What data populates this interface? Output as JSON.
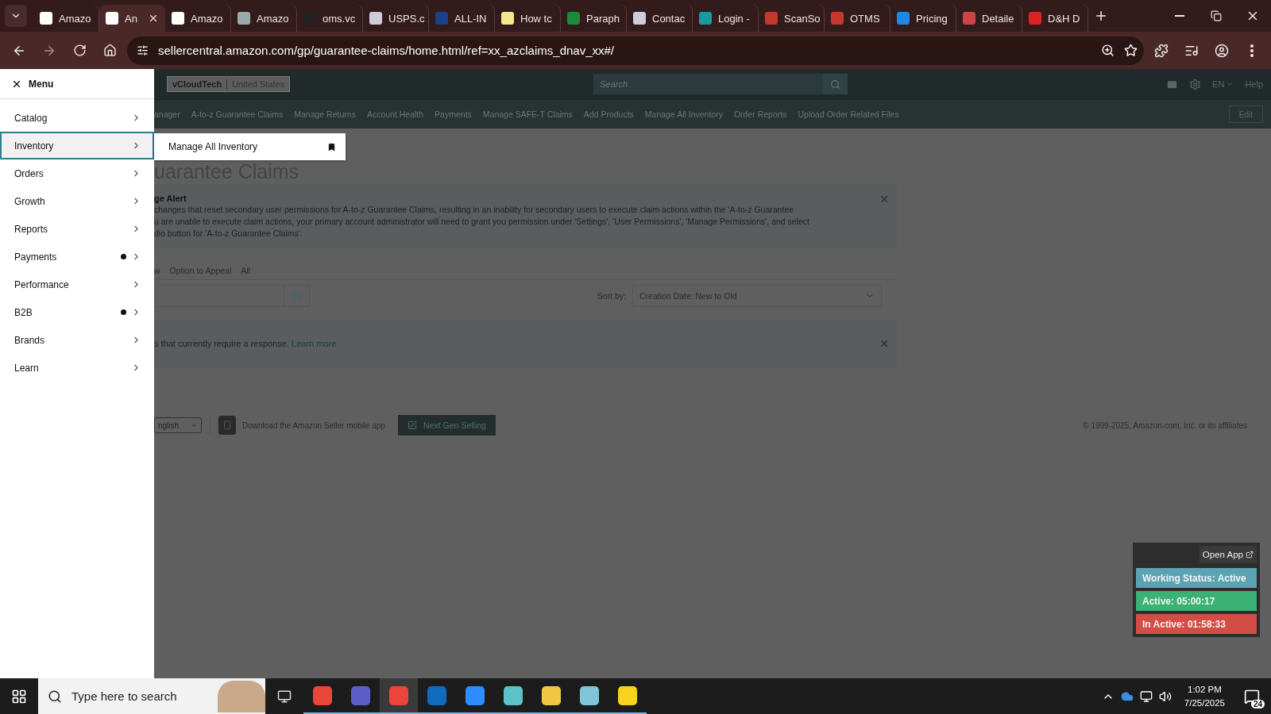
{
  "browser": {
    "tabs": [
      {
        "title": "Amazo",
        "selected": false
      },
      {
        "title": "An",
        "selected": true
      },
      {
        "title": "Amazo",
        "selected": false
      },
      {
        "title": "Amazo",
        "selected": false
      },
      {
        "title": "oms.vc",
        "selected": false
      },
      {
        "title": "USPS.c",
        "selected": false
      },
      {
        "title": "ALL-IN",
        "selected": false
      },
      {
        "title": "How tc",
        "selected": false
      },
      {
        "title": "Paraph",
        "selected": false
      },
      {
        "title": "Contac",
        "selected": false
      },
      {
        "title": "Login -",
        "selected": false
      },
      {
        "title": "ScanSo",
        "selected": false
      },
      {
        "title": "OTMS",
        "selected": false
      },
      {
        "title": "Pricing",
        "selected": false
      },
      {
        "title": "Detaile",
        "selected": false
      },
      {
        "title": "D&H D",
        "selected": false
      }
    ],
    "address": "sellercentral.amazon.com/gp/guarantee-claims/home.html/ref=xx_azclaims_dnav_xx#/"
  },
  "menu": {
    "title": "Menu",
    "items": [
      {
        "label": "Catalog",
        "selected": false,
        "dot": false
      },
      {
        "label": "Inventory",
        "selected": true,
        "dot": false
      },
      {
        "label": "Orders",
        "selected": false,
        "dot": false
      },
      {
        "label": "Growth",
        "selected": false,
        "dot": false
      },
      {
        "label": "Reports",
        "selected": false,
        "dot": false
      },
      {
        "label": "Payments",
        "selected": false,
        "dot": true
      },
      {
        "label": "Performance",
        "selected": false,
        "dot": false
      },
      {
        "label": "B2B",
        "selected": false,
        "dot": true
      },
      {
        "label": "Brands",
        "selected": false,
        "dot": false
      },
      {
        "label": "Learn",
        "selected": false,
        "dot": false
      }
    ],
    "flyout": {
      "label": "Manage All Inventory"
    }
  },
  "header": {
    "account": "vCloudTech",
    "marketplace": "United States",
    "search_placeholder": "Search",
    "language": "EN",
    "help": "Help"
  },
  "nav": {
    "items": [
      "anager",
      "A-to-z Guarantee Claims",
      "Manage Returns",
      "Account Health",
      "Payments",
      "Manage SAFE-T Claims",
      "Add Products",
      "Manage All Inventory",
      "Order Reports",
      "Upload Order Related Files"
    ],
    "edit": "Edit"
  },
  "page": {
    "heading": "uarantee Claims",
    "alert": {
      "title": "ge Alert",
      "lines": [
        "changes that reset secondary user permissions for A-to-z Guarantee Claims, resulting in an inability for secondary users to execute claim actions within the 'A-to-z Guarantee",
        "u are unable to execute claim actions, your primary account administrator will need to grant you permission under 'Settings', 'User Permissions', 'Manage Permissions', and select",
        "dio button for 'A-to-z Guarantee Claims'."
      ]
    },
    "tabs": [
      "w",
      "Option to Appeal",
      "All"
    ],
    "sort_label": "Sort by:",
    "sort_value": "Creation Date: New to Old",
    "notice": "s that currently require a response.",
    "notice_link": "Learn more"
  },
  "footer": {
    "language": "nglish",
    "app_link": "Download the Amazon Seller mobile app",
    "next_gen": "Next Gen Selling",
    "copyright": "© 1999-2025, Amazon.com, Inc. or its affiliates"
  },
  "widget": {
    "open": "Open App",
    "statuses": [
      {
        "text": "Working Status: Active",
        "color": "#5ba3b3"
      },
      {
        "text": "Active: 05:00:17",
        "color": "#3bb273"
      },
      {
        "text": "In Active: 01:58:33",
        "color": "#d44d45"
      }
    ]
  },
  "taskbar": {
    "search_placeholder": "Type here to search",
    "time": "1:02 PM",
    "date": "7/25/2025",
    "notifications": "24"
  }
}
